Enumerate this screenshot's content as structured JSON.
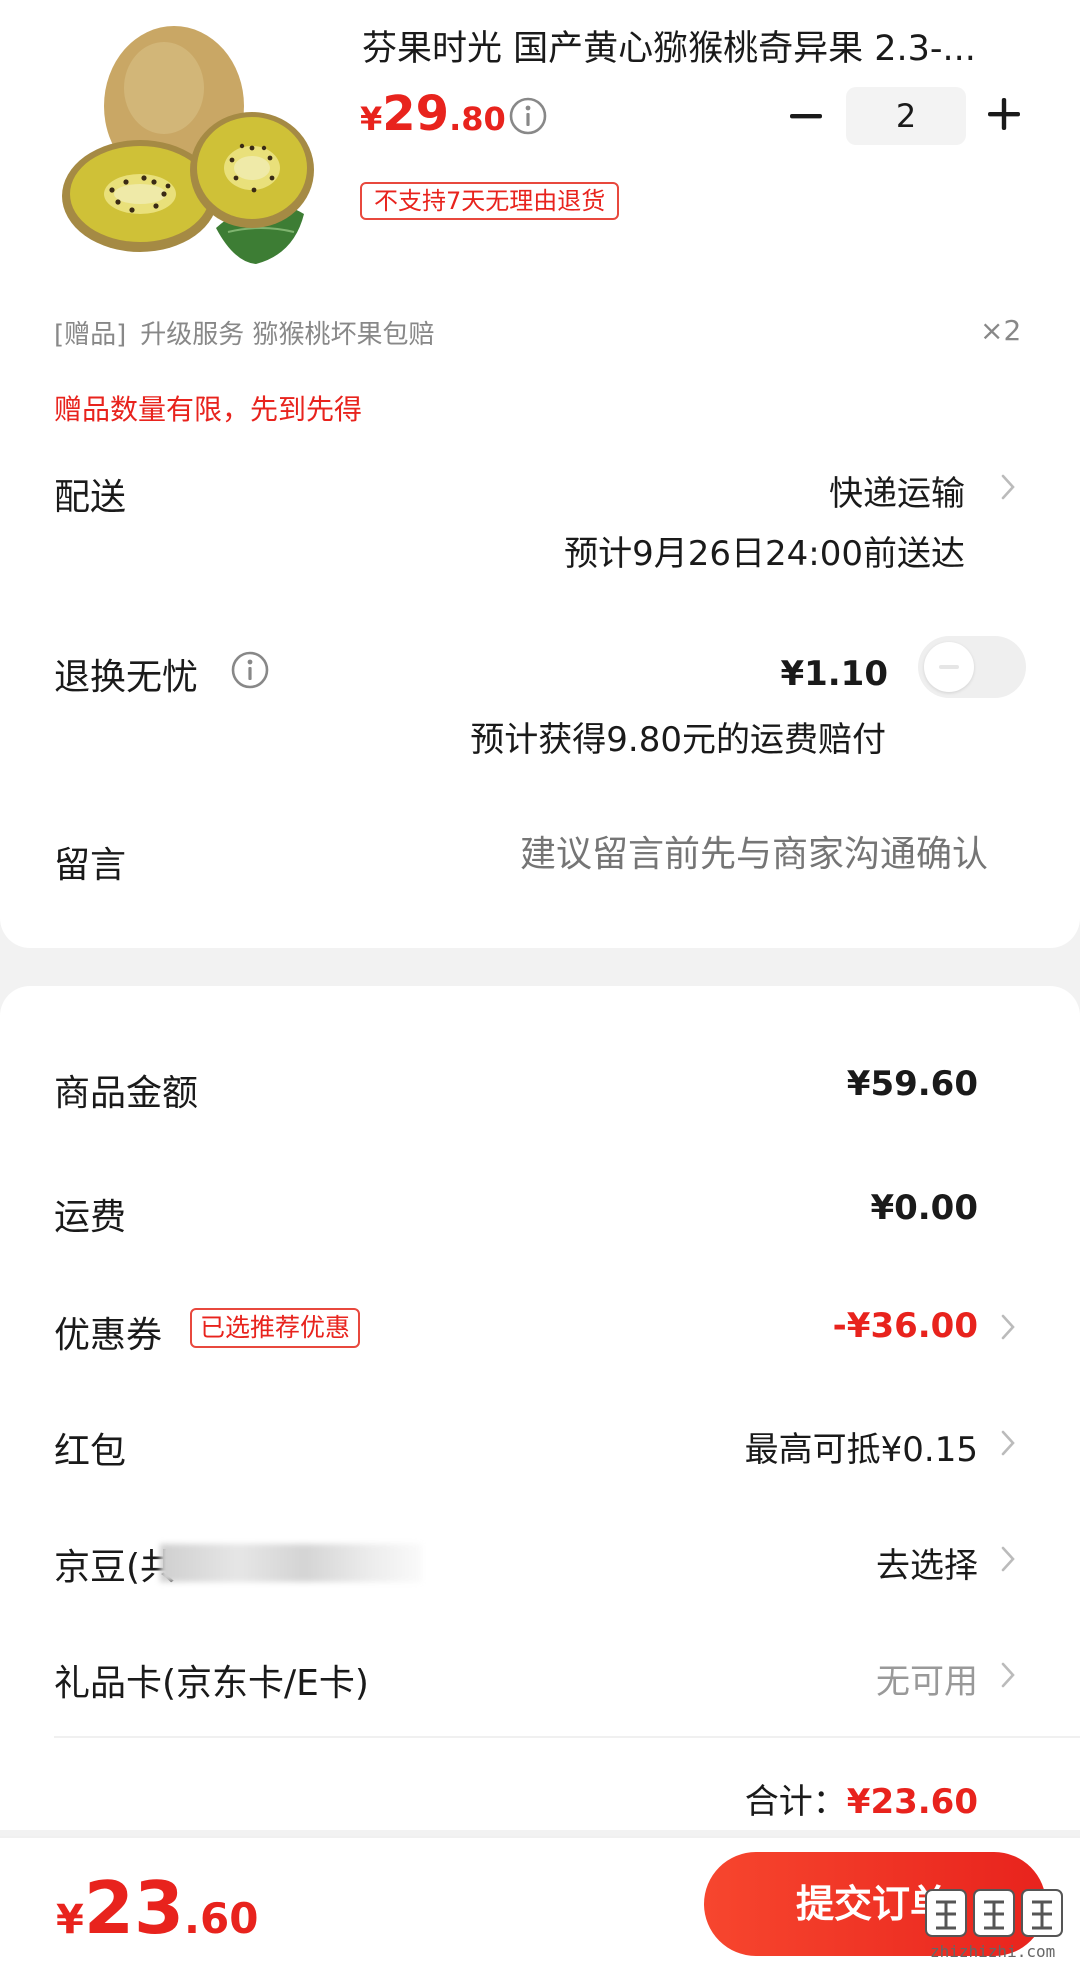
{
  "product": {
    "title": "芬果时光 国产黄心猕猴桃奇异果 2.3-...",
    "price_symbol": "¥",
    "price_int": "29",
    "price_dec": ".80",
    "quantity": "2",
    "no_return_badge": "不支持7天无理由退货",
    "image_icon": "kiwi-fruit-image"
  },
  "gift": {
    "tag": "[赠品]",
    "name": "升级服务 猕猴桃坏果包赔",
    "qty": "×2",
    "limit_notice": "赠品数量有限，先到先得"
  },
  "delivery": {
    "label": "配送",
    "method": "快递运输",
    "eta": "预计9月26日24:00前送达"
  },
  "return_service": {
    "label": "退换无忧",
    "price": "¥1.10",
    "compensation": "预计获得9.80元的运费赔付",
    "enabled": false
  },
  "message": {
    "label": "留言",
    "placeholder": "建议留言前先与商家沟通确认"
  },
  "summary": {
    "goods_label": "商品金额",
    "goods_value": "¥59.60",
    "shipping_label": "运费",
    "shipping_value": "¥0.00",
    "coupon_label": "优惠券",
    "coupon_badge": "已选推荐优惠",
    "coupon_value": "-¥36.00",
    "redpacket_label": "红包",
    "redpacket_value": "最高可抵¥0.15",
    "jingdou_label": "京豆(共",
    "jingdou_value": "去选择",
    "giftcard_label": "礼品卡(京东卡/E卡)",
    "giftcard_value": "无可用",
    "total_label": "合计：",
    "total_value": "¥23.60"
  },
  "footer": {
    "price_symbol": "¥",
    "price_int": "23",
    "price_dec": ".60",
    "submit_label": "提交订单",
    "watermark": "zhizhizhi.com"
  },
  "colors": {
    "accent": "#e8231d",
    "muted": "#888888"
  }
}
